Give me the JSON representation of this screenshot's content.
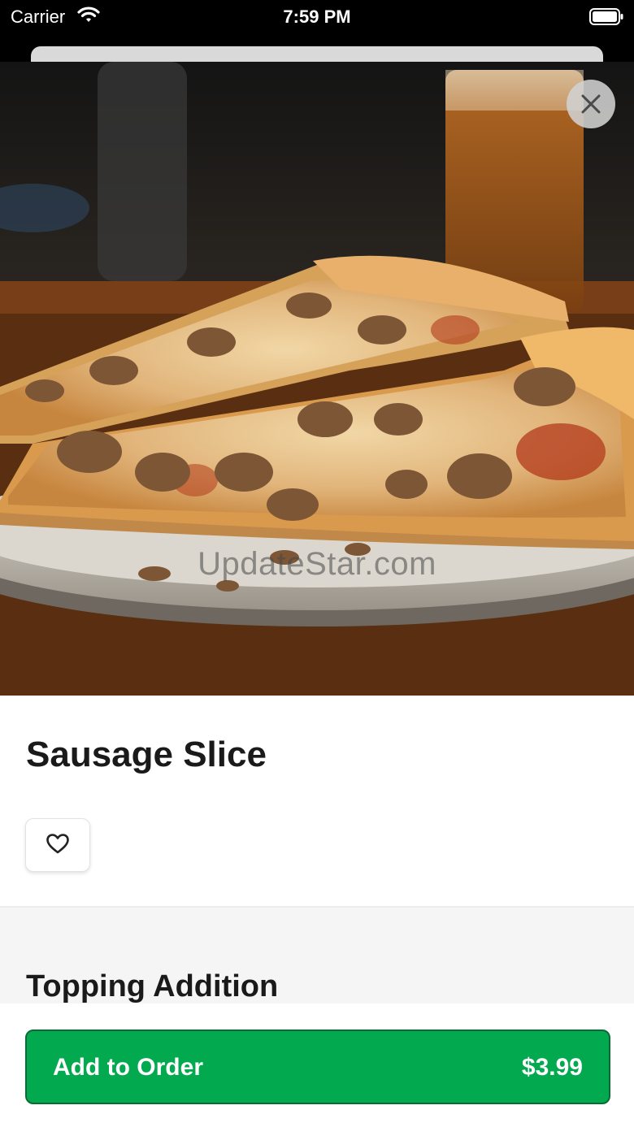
{
  "status_bar": {
    "carrier": "Carrier",
    "time": "7:59 PM"
  },
  "item": {
    "name": "Sausage Slice",
    "image_watermark": "UpdateStar.com"
  },
  "options": {
    "section_title": "Topping Addition"
  },
  "footer": {
    "add_label": "Add to Order",
    "price": "$3.99"
  },
  "colors": {
    "accent": "#03a94e",
    "background": "#ffffff",
    "section_background": "#f5f5f5"
  },
  "icons": [
    "wifi-icon",
    "battery-icon",
    "close-icon",
    "heart-icon"
  ]
}
